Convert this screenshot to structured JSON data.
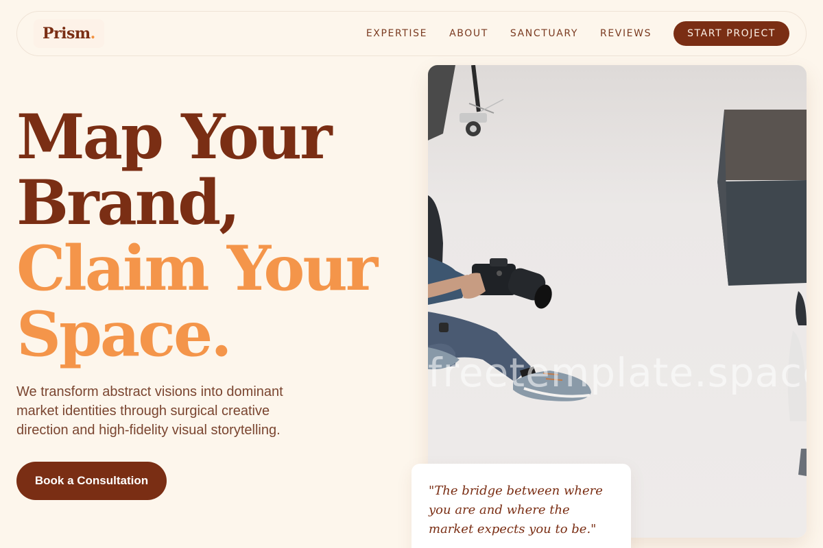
{
  "brand": {
    "name": "Prism",
    "dot": ".",
    "primary_color": "#7a2e14",
    "accent_color": "#f4954a",
    "background_color": "#fdf6ec"
  },
  "nav": {
    "links": [
      "EXPERTISE",
      "ABOUT",
      "SANCTUARY",
      "REVIEWS"
    ],
    "cta_label": "START PROJECT"
  },
  "hero": {
    "headline_line1": "Map Your",
    "headline_line2": "Brand,",
    "headline_line3": "Claim Your",
    "headline_line4": "Space.",
    "subtext": "We transform abstract visions into dominant market identities through surgical creative direction and high-fidelity visual storytelling.",
    "button_label": "Book a Consultation"
  },
  "image": {
    "watermark": "freetemplate.space"
  },
  "quote": {
    "text": "\"The bridge between where you are and where the market expects you to be.\""
  }
}
